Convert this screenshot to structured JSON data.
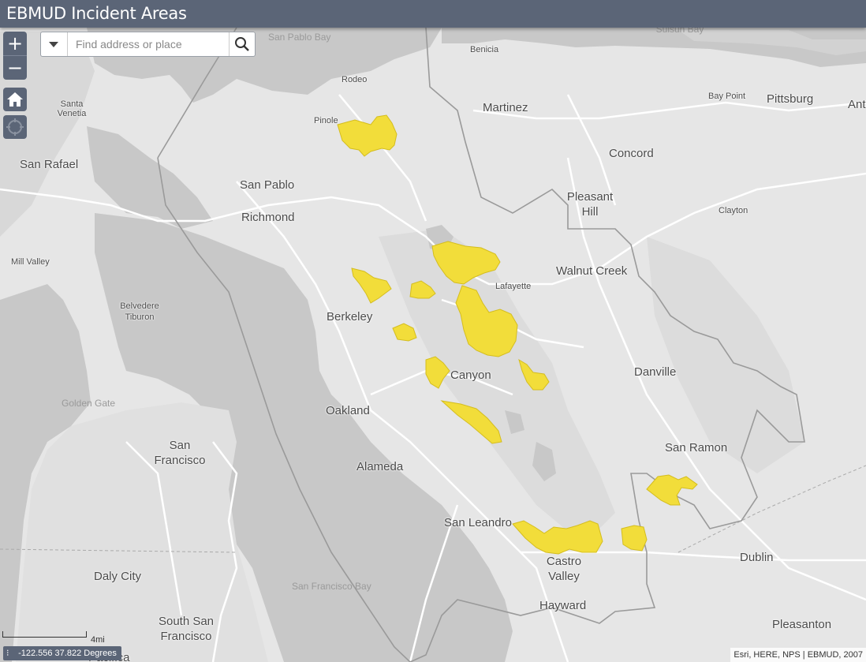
{
  "app": {
    "title": "EBMUD Incident Areas"
  },
  "search": {
    "placeholder": "Find address or place"
  },
  "zoom": {
    "in": "+",
    "out": "−"
  },
  "scale": {
    "label": "4mi"
  },
  "coords": {
    "text": "-122.556 37.822 Degrees"
  },
  "attribution": "Esri, HERE, NPS | EBMUD, 2007",
  "colors": {
    "header": "#5b6577",
    "incident_fill": "#f2dd3a",
    "land": "#e6e6e6",
    "water": "#c8c8c8",
    "boundary": "#9a9a9a"
  },
  "places": {
    "san_pablo_bay": "San Pablo Bay",
    "suisun_bay": "Suisun Bay",
    "benicia": "Benicia",
    "rodeo": "Rodeo",
    "martinez": "Martinez",
    "bay_point": "Bay Point",
    "pittsburg": "Pittsburg",
    "antioch": "Ant",
    "santa_venetia": "Santa Venetia",
    "pinole": "Pinole",
    "concord": "Concord",
    "san_rafael": "San Rafael",
    "san_pablo": "San Pablo",
    "pleasant_hill": "Pleasant Hill",
    "clayton": "Clayton",
    "richmond": "Richmond",
    "mill_valley": "Mill Valley",
    "walnut_creek": "Walnut Creek",
    "lafayette": "Lafayette",
    "belvedere_tiburon": "Belvedere Tiburon",
    "berkeley": "Berkeley",
    "danville": "Danville",
    "canyon": "Canyon",
    "golden_gate": "Golden Gate",
    "oakland": "Oakland",
    "san_francisco": "San Francisco",
    "san_ramon": "San Ramon",
    "alameda": "Alameda",
    "san_leandro": "San Leandro",
    "dublin": "Dublin",
    "castro_valley": "Castro Valley",
    "daly_city": "Daly City",
    "san_francisco_bay": "San Francisco Bay",
    "hayward": "Hayward",
    "south_san_francisco": "South San Francisco",
    "pleasanton": "Pleasanton",
    "pacifica": "Pacifica"
  }
}
